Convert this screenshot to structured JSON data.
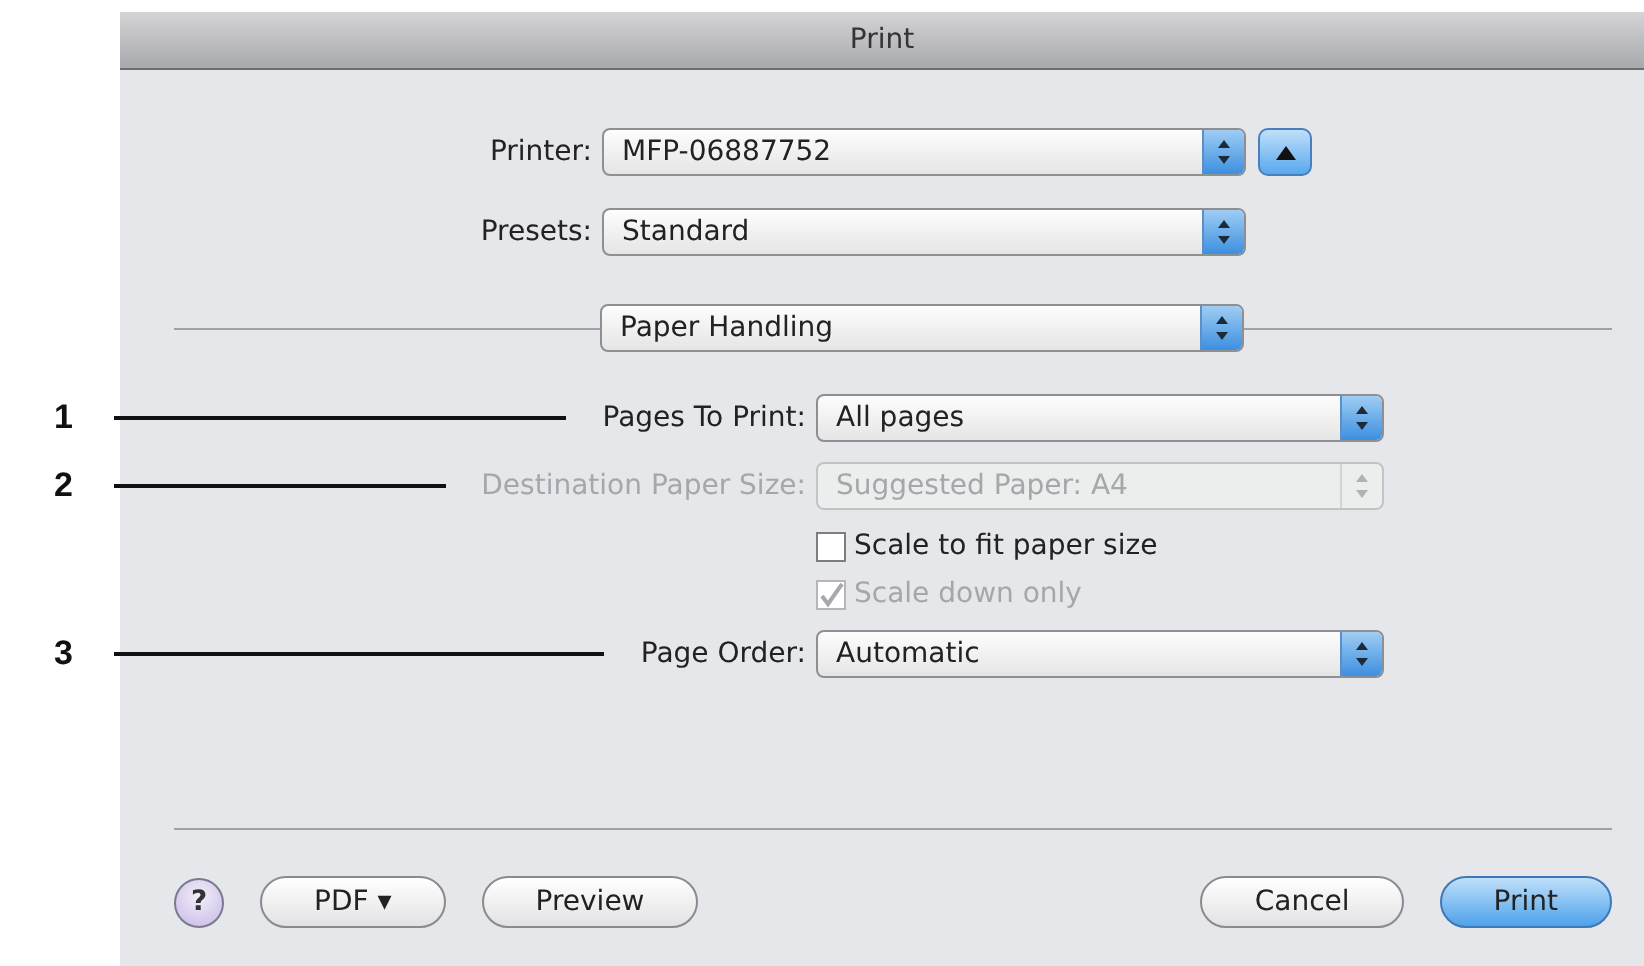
{
  "window": {
    "title": "Print"
  },
  "printer": {
    "label": "Printer:",
    "value": "MFP-06887752",
    "expanded": true
  },
  "presets": {
    "label": "Presets:",
    "value": "Standard"
  },
  "panel_menu": {
    "value": "Paper Handling"
  },
  "options": [
    {
      "kind": "popup",
      "callout": "1",
      "label": "Pages To Print:",
      "value": "All pages",
      "disabled": false
    },
    {
      "kind": "popup",
      "callout": "2",
      "label": "Destination Paper Size:",
      "value": "Suggested Paper: A4",
      "disabled": true
    },
    {
      "kind": "checkbox",
      "label": "Scale to fit paper size",
      "checked": false,
      "disabled": false
    },
    {
      "kind": "checkbox",
      "label": "Scale down only",
      "checked": true,
      "disabled": true
    },
    {
      "kind": "popup",
      "callout": "3",
      "label": "Page Order:",
      "value": "Automatic",
      "disabled": false
    }
  ],
  "help": "?",
  "left_buttons": [
    {
      "label": "PDF ▾",
      "default": false
    },
    {
      "label": "Preview",
      "default": false
    }
  ],
  "right_buttons": [
    {
      "label": "Cancel",
      "default": false
    },
    {
      "label": "Print",
      "default": true
    }
  ]
}
